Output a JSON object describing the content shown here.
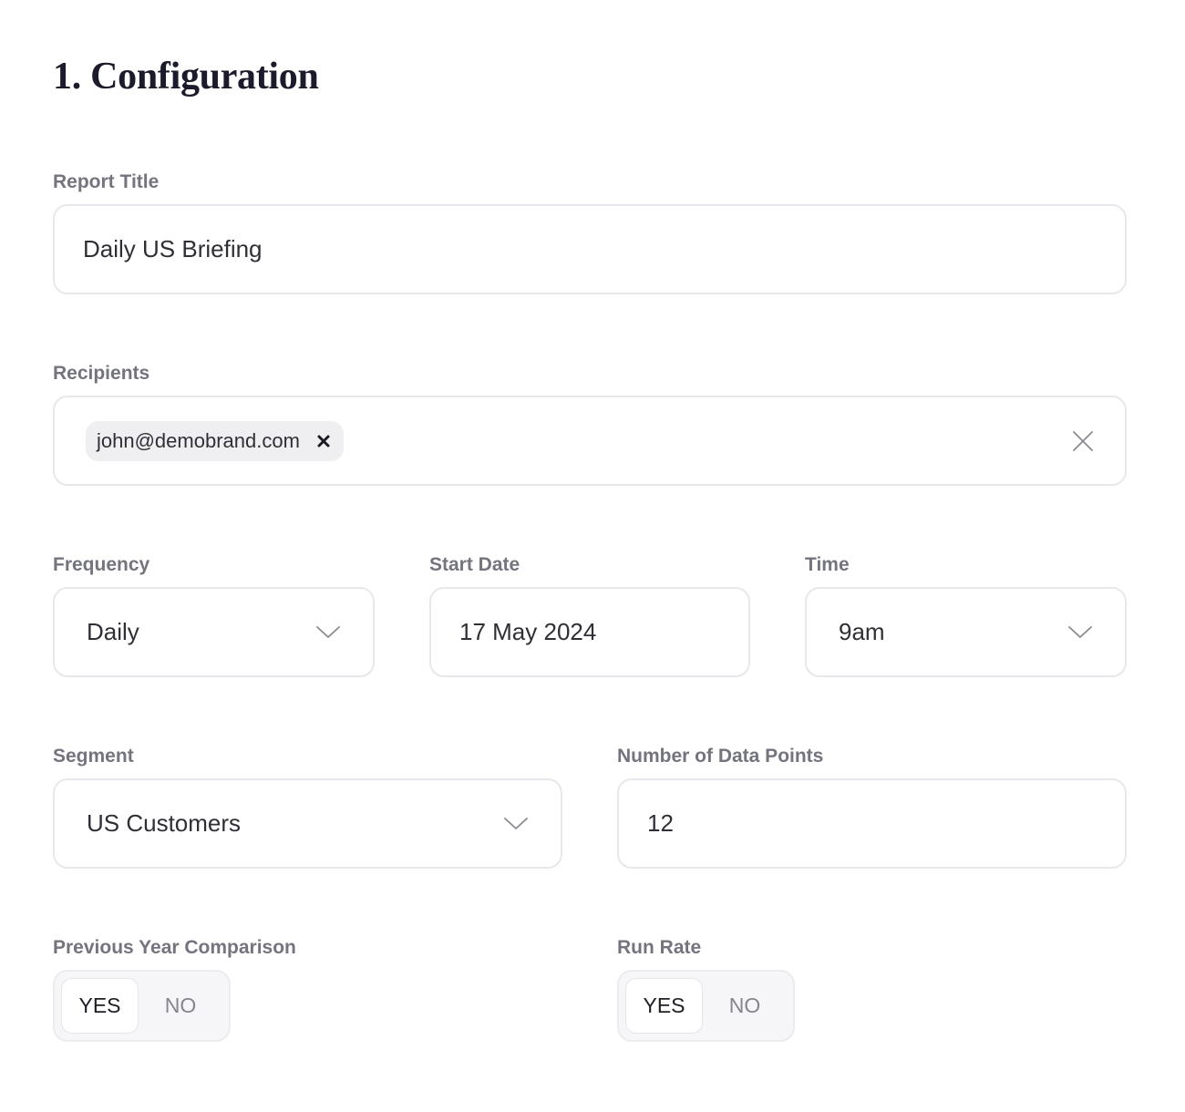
{
  "section": {
    "title": "1. Configuration"
  },
  "report_title": {
    "label": "Report Title",
    "value": "Daily US Briefing"
  },
  "recipients": {
    "label": "Recipients",
    "chips": [
      "john@demobrand.com"
    ]
  },
  "frequency": {
    "label": "Frequency",
    "value": "Daily"
  },
  "start_date": {
    "label": "Start Date",
    "value": "17 May 2024"
  },
  "time": {
    "label": "Time",
    "value": "9am"
  },
  "segment": {
    "label": "Segment",
    "value": "US Customers"
  },
  "data_points": {
    "label": "Number of Data Points",
    "value": "12"
  },
  "prev_year": {
    "label": "Previous Year Comparison",
    "yes": "YES",
    "no": "NO",
    "selected": "YES"
  },
  "run_rate": {
    "label": "Run Rate",
    "yes": "YES",
    "no": "NO",
    "selected": "YES"
  },
  "icons": {
    "chevron": "chevron-down-icon",
    "chip_remove": "close-icon",
    "clear": "close-icon"
  },
  "colors": {
    "label": "#74747f",
    "border": "#e8e8ec",
    "title": "#1b1b2b"
  }
}
